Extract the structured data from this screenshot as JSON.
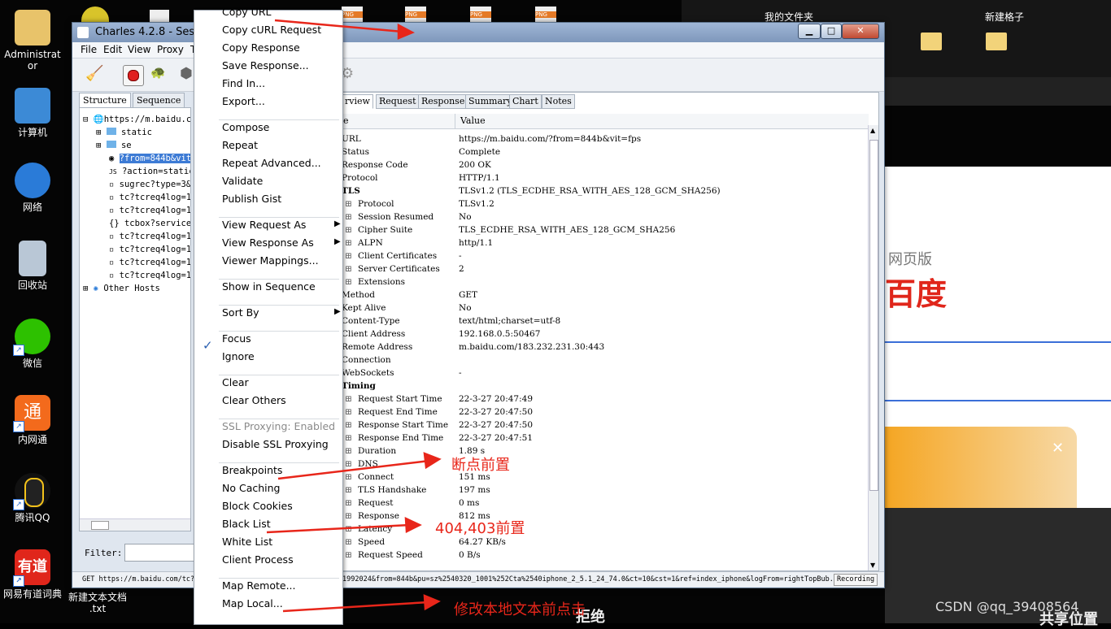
{
  "desktop": {
    "icons": [
      {
        "label": "Administrat\nor",
        "icon": "user-folder-icon"
      },
      {
        "label": "计算机",
        "icon": "computer-icon"
      },
      {
        "label": "网络",
        "icon": "network-globe-icon"
      },
      {
        "label": "回收站",
        "icon": "recycle-bin-icon"
      },
      {
        "label": "微信",
        "icon": "wechat-icon"
      },
      {
        "label": "内网通",
        "icon": "neiwangtong-icon"
      },
      {
        "label": "腾讯QQ",
        "icon": "qq-penguin-icon"
      },
      {
        "label": "网易有道词典",
        "icon": "youdao-icon"
      },
      {
        "label": "新建文本文档\n.txt",
        "icon": "text-file-icon"
      }
    ],
    "top_right": {
      "folder1": "我的文件夹",
      "folder2": "新建格子"
    },
    "right_panel": {
      "web_version": "网页版",
      "baidu": "百度",
      "watermark": "CSDN @qq_39408564",
      "bottom_text1": "拒绝",
      "bottom_text2": "共享位置"
    }
  },
  "window": {
    "title": "Charles 4.2.8 - Sessio",
    "menu": [
      "File",
      "Edit",
      "View",
      "Proxy",
      "T"
    ],
    "left_tabs": [
      "Structure",
      "Sequence"
    ],
    "tree": [
      "https://m.baidu.c",
      "static",
      "se",
      "?from=844b&vit=",
      "?action=static",
      "sugrec?type=3&",
      "tc?tcreq4log=1",
      "tc?tcreq4log=1",
      "tcbox?service=",
      "tc?tcreq4log=1",
      "tc?tcreq4log=1",
      "tc?tcreq4log=1",
      "tc?tcreq4log=1",
      "Other Hosts"
    ],
    "filter_label": "Filter:",
    "right_tabs": [
      "rview",
      "Request",
      "Response",
      "Summary",
      "Chart",
      "Notes"
    ],
    "col_name": "e",
    "col_value": "Value",
    "rows": [
      {
        "n": "URL",
        "v": "https://m.baidu.com/?from=844b&vit=fps",
        "lvl": 0
      },
      {
        "n": "Status",
        "v": "Complete",
        "lvl": 0
      },
      {
        "n": "Response Code",
        "v": "200 OK",
        "lvl": 0
      },
      {
        "n": "Protocol",
        "v": "HTTP/1.1",
        "lvl": 0
      },
      {
        "n": "TLS",
        "v": "TLSv1.2 (TLS_ECDHE_RSA_WITH_AES_128_GCM_SHA256)",
        "lvl": 0,
        "bold": true
      },
      {
        "n": "Protocol",
        "v": "TLSv1.2",
        "lvl": 1
      },
      {
        "n": "Session Resumed",
        "v": "No",
        "lvl": 1
      },
      {
        "n": "Cipher Suite",
        "v": "TLS_ECDHE_RSA_WITH_AES_128_GCM_SHA256",
        "lvl": 1
      },
      {
        "n": "ALPN",
        "v": "http/1.1",
        "lvl": 1
      },
      {
        "n": "Client Certificates",
        "v": "-",
        "lvl": 1
      },
      {
        "n": "Server Certificates",
        "v": "2",
        "lvl": 1
      },
      {
        "n": "Extensions",
        "v": "",
        "lvl": 1
      },
      {
        "n": "Method",
        "v": "GET",
        "lvl": 0
      },
      {
        "n": "Kept Alive",
        "v": "No",
        "lvl": 0
      },
      {
        "n": "Content-Type",
        "v": "text/html;charset=utf-8",
        "lvl": 0
      },
      {
        "n": "Client Address",
        "v": "192.168.0.5:50467",
        "lvl": 0
      },
      {
        "n": "Remote Address",
        "v": "m.baidu.com/183.232.231.30:443",
        "lvl": 0
      },
      {
        "n": "Connection",
        "v": "",
        "lvl": 0
      },
      {
        "n": "WebSockets",
        "v": "-",
        "lvl": 0
      },
      {
        "n": "Timing",
        "v": "",
        "lvl": 0,
        "bold": true
      },
      {
        "n": "Request Start Time",
        "v": "22-3-27 20:47:49",
        "lvl": 1
      },
      {
        "n": "Request End Time",
        "v": "22-3-27 20:47:50",
        "lvl": 1
      },
      {
        "n": "Response Start Time",
        "v": "22-3-27 20:47:50",
        "lvl": 1
      },
      {
        "n": "Response End Time",
        "v": "22-3-27 20:47:51",
        "lvl": 1
      },
      {
        "n": "Duration",
        "v": "1.89 s",
        "lvl": 1
      },
      {
        "n": "DNS",
        "v": "",
        "lvl": 1
      },
      {
        "n": "Connect",
        "v": "151 ms",
        "lvl": 1
      },
      {
        "n": "TLS Handshake",
        "v": "197 ms",
        "lvl": 1
      },
      {
        "n": "Request",
        "v": "0 ms",
        "lvl": 1
      },
      {
        "n": "Response",
        "v": "812 ms",
        "lvl": 1
      },
      {
        "n": "Latency",
        "v": "",
        "lvl": 1
      },
      {
        "n": "Speed",
        "v": "64.27 KB/s",
        "lvl": 1
      },
      {
        "n": "Request Speed",
        "v": "0 B/s",
        "lvl": 1
      }
    ],
    "status_text": "GET https://m.baidu.com/tc?",
    "status_text2": "1992024&from=844b&pu=sz%2540320_1001%252Cta%2540iphone_2_5.1_24_74.0&ct=10&cst=1&ref=index_iphone&logFrom=rightTopBub...",
    "recording": "Recording"
  },
  "context_menu": {
    "items": [
      {
        "label": "Copy URL",
        "top": 0
      },
      {
        "label": "Copy cURL Request"
      },
      {
        "label": "Copy Response"
      },
      {
        "label": "Save Response..."
      },
      {
        "label": "Find In..."
      },
      {
        "label": "Export..."
      },
      {
        "label": "Compose"
      },
      {
        "label": "Repeat"
      },
      {
        "label": "Repeat Advanced..."
      },
      {
        "label": "Validate"
      },
      {
        "label": "Publish Gist"
      },
      {
        "label": "View Request As"
      },
      {
        "label": "View Response As"
      },
      {
        "label": "Viewer Mappings..."
      },
      {
        "label": "Show in Sequence"
      },
      {
        "label": "Sort By"
      },
      {
        "label": "Focus"
      },
      {
        "label": "Ignore"
      },
      {
        "label": "Clear"
      },
      {
        "label": "Clear Others"
      },
      {
        "label": "SSL Proxying: Enabled"
      },
      {
        "label": "Disable SSL Proxying"
      },
      {
        "label": "Breakpoints"
      },
      {
        "label": "No Caching"
      },
      {
        "label": "Block Cookies"
      },
      {
        "label": "Black List"
      },
      {
        "label": "White List"
      },
      {
        "label": "Client Process"
      },
      {
        "label": "Map Remote..."
      },
      {
        "label": "Map Local..."
      }
    ]
  },
  "annotations": {
    "breakpoint": "断点前置",
    "blacklist": "404,403前置",
    "maplocal": "修改本地文本前点击"
  },
  "colors": {
    "annotation": "#e8261a",
    "accent": "#2a6fd6"
  }
}
